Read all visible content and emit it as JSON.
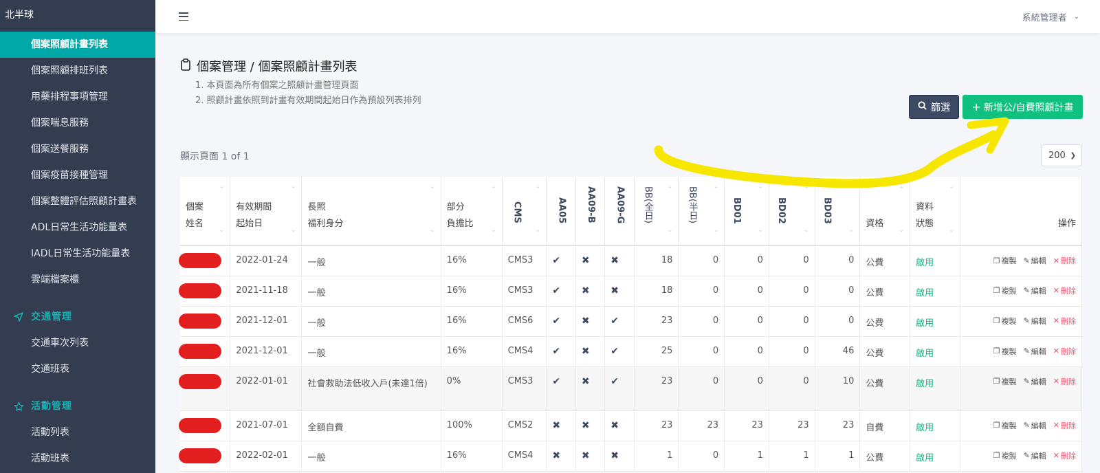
{
  "sidebar": {
    "brand": "北半球",
    "items": [
      {
        "label": "個案照顧計畫列表",
        "active": true
      },
      {
        "label": "個案照顧排班列表"
      },
      {
        "label": "用藥排程事項管理"
      },
      {
        "label": "個案喘息服務"
      },
      {
        "label": "個案送餐服務"
      },
      {
        "label": "個案疫苗接種管理"
      },
      {
        "label": "個案整體評估照顧計畫表"
      },
      {
        "label": "ADL日常生活功能量表"
      },
      {
        "label": "IADL日常生活功能量表"
      },
      {
        "label": "雲端檔案櫃"
      }
    ],
    "sections": [
      {
        "label": "交通管理",
        "icon": "send-icon",
        "items": [
          {
            "label": "交通車次列表"
          },
          {
            "label": "交通班表"
          }
        ]
      },
      {
        "label": "活動管理",
        "icon": "star-icon",
        "items": [
          {
            "label": "活動列表"
          },
          {
            "label": "活動班表"
          }
        ]
      }
    ]
  },
  "topbar": {
    "menu_icon": "hamburger-icon",
    "user": "系統管理者"
  },
  "page": {
    "title": "個案管理 / 個案照顧計畫列表",
    "notes": [
      "1. 本頁面為所有個案之照顧計畫管理頁面",
      "2. 照顧計畫依照到計畫有效期間起始日作為預設列表排列"
    ],
    "filter_button": "篩選",
    "add_button": "新增公/自費照顧計畫",
    "page_info": "顯示頁面 1 of 1",
    "page_size": "200"
  },
  "table": {
    "headers": {
      "name": [
        "個案",
        "姓名"
      ],
      "start": [
        "有效期間",
        "起始日"
      ],
      "welfare": [
        "長照",
        "福利身分"
      ],
      "ratio": [
        "部分",
        "負擔比"
      ],
      "cms": "CMS",
      "aa05": "AA05",
      "aa09b": "AA09-B",
      "aa09g": "AA09-G",
      "bb_full": "BB(全日)",
      "bb_half": "BB(半日)",
      "bd01": "BD01",
      "bd02": "BD02",
      "bd03": "BD03",
      "qual": "資格",
      "status": [
        "資料",
        "狀態"
      ],
      "ops": "操作"
    },
    "actions": {
      "copy": "複製",
      "edit": "編輯",
      "delete": "刪除"
    },
    "rows": [
      {
        "start": "2022-01-24",
        "welfare": "一般",
        "ratio": "16%",
        "cms": "CMS3",
        "aa05": "✔",
        "aa09b": "✖",
        "aa09g": "✖",
        "bb_full": "18",
        "bb_half": "0",
        "bd01": "0",
        "bd02": "0",
        "bd03": "0",
        "qual": "公費",
        "status": "啟用"
      },
      {
        "start": "2021-11-18",
        "welfare": "一般",
        "ratio": "16%",
        "cms": "CMS3",
        "aa05": "✔",
        "aa09b": "✖",
        "aa09g": "✖",
        "bb_full": "18",
        "bb_half": "0",
        "bd01": "0",
        "bd02": "0",
        "bd03": "0",
        "qual": "公費",
        "status": "啟用"
      },
      {
        "start": "2021-12-01",
        "welfare": "一般",
        "ratio": "16%",
        "cms": "CMS6",
        "aa05": "✔",
        "aa09b": "✖",
        "aa09g": "✔",
        "bb_full": "23",
        "bb_half": "0",
        "bd01": "0",
        "bd02": "0",
        "bd03": "0",
        "qual": "公費",
        "status": "啟用"
      },
      {
        "start": "2021-12-01",
        "welfare": "一般",
        "ratio": "16%",
        "cms": "CMS4",
        "aa05": "✔",
        "aa09b": "✖",
        "aa09g": "✔",
        "bb_full": "25",
        "bb_half": "0",
        "bd01": "0",
        "bd02": "0",
        "bd03": "46",
        "qual": "公費",
        "status": "啟用"
      },
      {
        "start": "2022-01-01",
        "welfare": "社會救助法低收入戶(未達1倍)",
        "ratio": "0%",
        "cms": "CMS3",
        "aa05": "✔",
        "aa09b": "✖",
        "aa09g": "✔",
        "bb_full": "23",
        "bb_half": "0",
        "bd01": "0",
        "bd02": "0",
        "bd03": "10",
        "qual": "公費",
        "status": "啟用",
        "tall": true
      },
      {
        "start": "2021-07-01",
        "welfare": "全額自費",
        "ratio": "100%",
        "cms": "CMS2",
        "aa05": "✖",
        "aa09b": "✖",
        "aa09g": "✖",
        "bb_full": "23",
        "bb_half": "23",
        "bd01": "23",
        "bd02": "23",
        "bd03": "23",
        "qual": "自費",
        "status": "啟用"
      },
      {
        "start": "2022-02-01",
        "welfare": "一般",
        "ratio": "16%",
        "cms": "CMS4",
        "aa05": "✖",
        "aa09b": "✖",
        "aa09g": "✖",
        "bb_full": "1",
        "bb_half": "0",
        "bd01": "1",
        "bd02": "1",
        "bd03": "1",
        "qual": "公費",
        "status": "啟用"
      }
    ]
  },
  "colors": {
    "sidebar_bg": "#343c50",
    "active_item": "#00a8a8",
    "section_label": "#17b2b2",
    "add_button": "#10c07f",
    "filter_button": "#3c4a64",
    "status_ok": "#10b57a",
    "delete": "#f0506e",
    "annotation": "#f7e600"
  }
}
